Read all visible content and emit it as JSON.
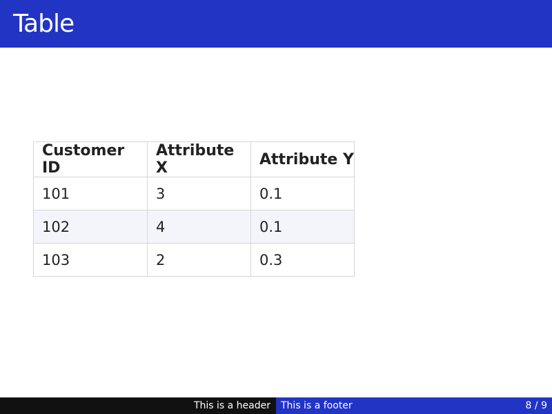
{
  "slide": {
    "title": "Table"
  },
  "table": {
    "headers": [
      "Customer ID",
      "Attribute X",
      "Attribute Y"
    ],
    "rows": [
      [
        "101",
        "3",
        "0.1"
      ],
      [
        "102",
        "4",
        "0.1"
      ],
      [
        "103",
        "2",
        "0.3"
      ]
    ]
  },
  "footer": {
    "header_text": "This is a header",
    "footer_text": "This is a footer",
    "page_current": "8",
    "page_separator": "/",
    "page_total": "9"
  },
  "colors": {
    "theme_blue": "#2234c4",
    "footer_dark": "#111111",
    "row_stripe": "#f4f5fa"
  }
}
